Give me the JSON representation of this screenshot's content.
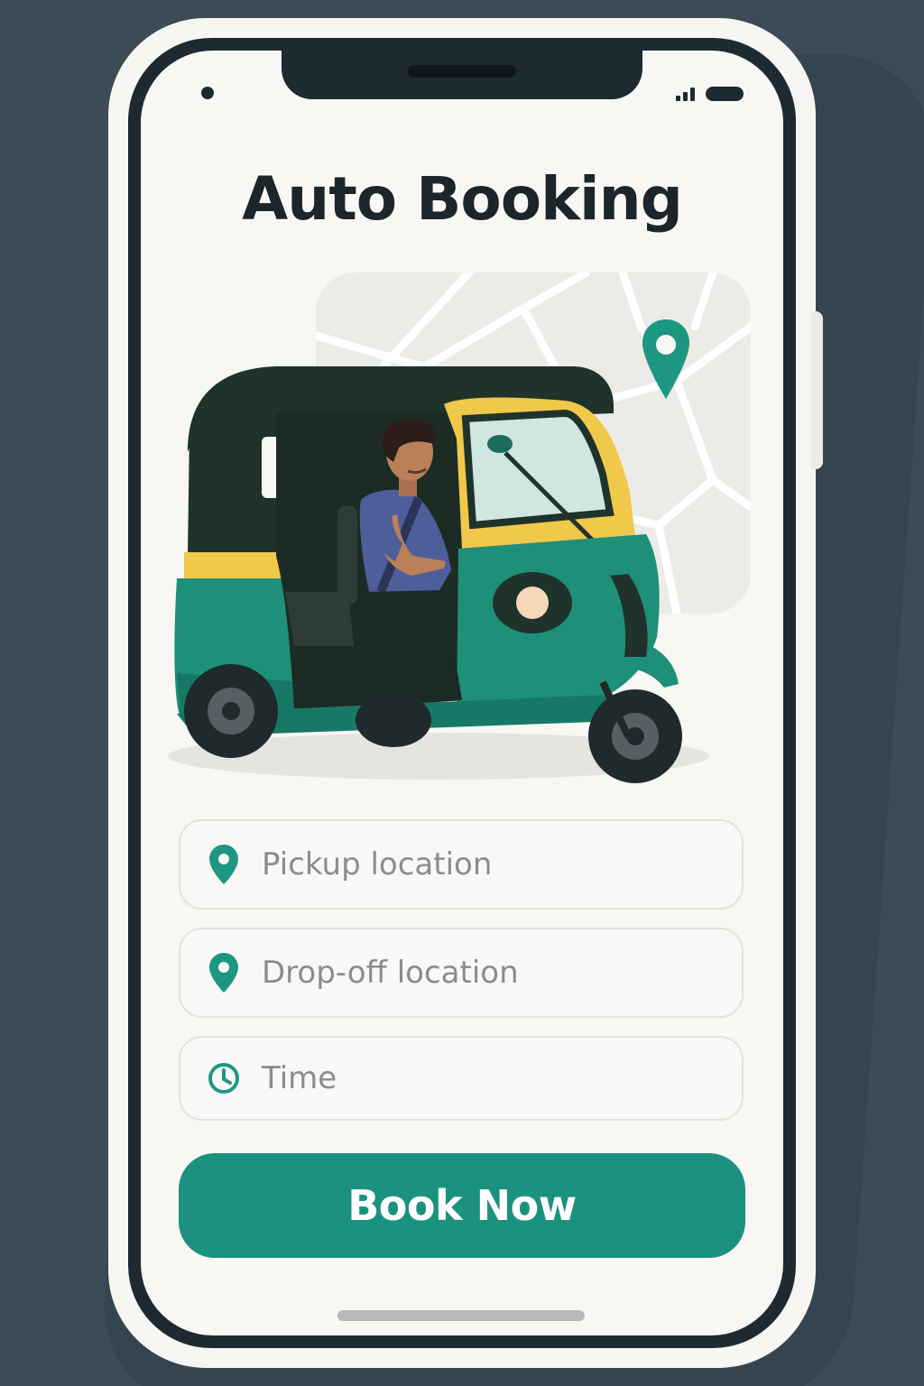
{
  "app": {
    "title": "Auto Booking"
  },
  "form": {
    "pickup": {
      "placeholder": "Pickup location",
      "icon": "location-pin-icon"
    },
    "dropoff": {
      "placeholder": "Drop-off location",
      "icon": "location-pin-icon"
    },
    "time": {
      "placeholder": "Time",
      "icon": "clock-icon"
    }
  },
  "actions": {
    "book_label": "Book Now"
  },
  "colors": {
    "accent": "#1c9180",
    "background": "#3c4b55",
    "auto_green": "#1e8f78",
    "auto_yellow": "#f0c84a",
    "auto_roof": "#1f332b"
  }
}
